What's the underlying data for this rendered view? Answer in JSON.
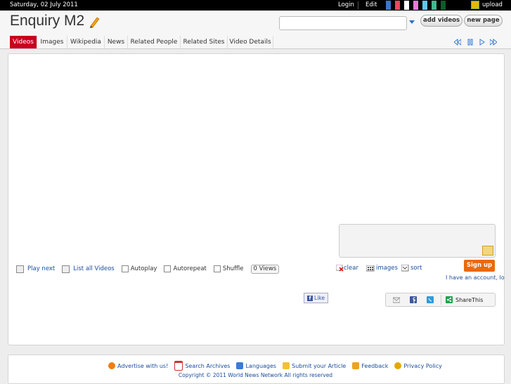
{
  "topbar": {
    "date": "Saturday, 02 July 2011",
    "login": "Login",
    "edit": "Edit",
    "upload": "upload",
    "swatches": [
      "#3f74c8",
      "#e6495e",
      "#8c0a16",
      "#ffffff",
      "#0f0f0f",
      "#e879d8",
      "#62c6ea",
      "#1a1a1a",
      "#43b88f",
      "#0f5c2a"
    ]
  },
  "header": {
    "brand": "Enquiry M2",
    "search_value": "",
    "add_videos": "add videos",
    "new_page": "new page"
  },
  "tabs": [
    "Videos",
    "Images",
    "Wikipedia",
    "News",
    "Related People",
    "Related Sites",
    "Video Details"
  ],
  "controls": {
    "play_next": "Play next",
    "list_all": "List all Videos",
    "autoplay": "Autoplay",
    "autorepeat": "Autorepeat",
    "shuffle": "Shuffle",
    "views": "0 Views"
  },
  "tools": {
    "clear": "clear",
    "images": "images",
    "sort": "sort",
    "signup": "Sign up",
    "account": "I have an account, lo"
  },
  "social": {
    "like": "Like",
    "sharethis": "ShareThis"
  },
  "footer": {
    "links": [
      "Advertise with us!",
      "Search Archives",
      "Languages",
      "Submit your Article",
      "Feedback",
      "Privacy Policy"
    ],
    "copyright": "Copyright © 2011 World News Network All rights reserved"
  }
}
